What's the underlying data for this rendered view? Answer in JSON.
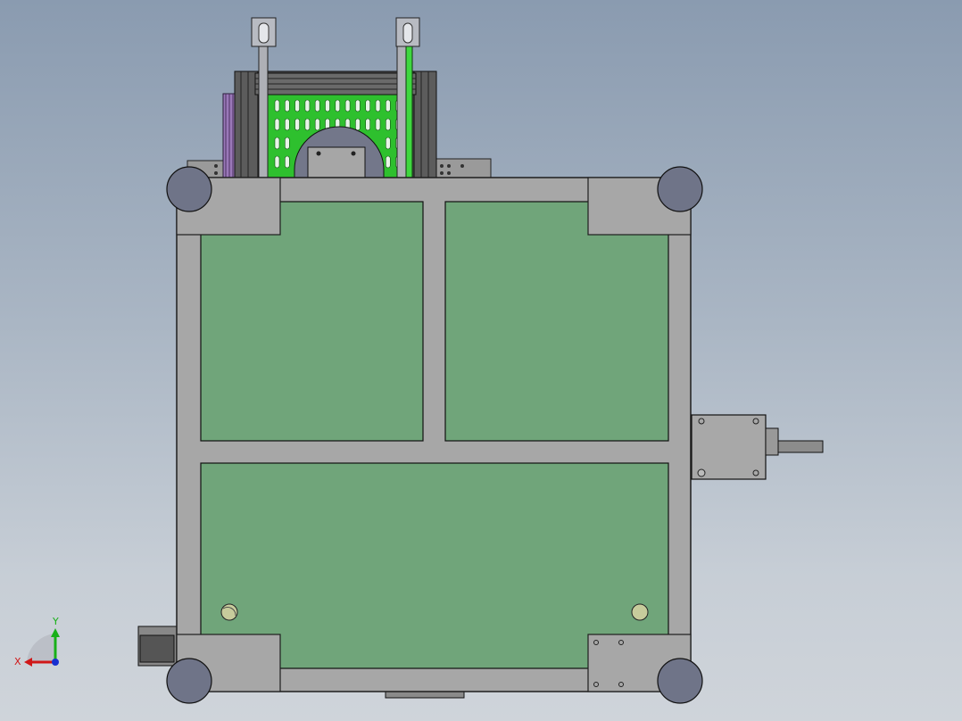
{
  "scene": {
    "description_visible_text": "none",
    "background_top": "#8a9bb0",
    "background_bottom": "#cfd4da"
  },
  "colors": {
    "frame": "#a7a7a7",
    "frame_edge": "#1e1e1e",
    "panel_fill": "#70a57a",
    "caster": "#6f7488",
    "green_part": "#3fbf3f",
    "purple_part": "#9a78b8"
  },
  "triad": {
    "x_label": "X",
    "y_label": "Y",
    "x_color": "#d01818",
    "y_color": "#18b018",
    "z_color": "#1830d0"
  }
}
